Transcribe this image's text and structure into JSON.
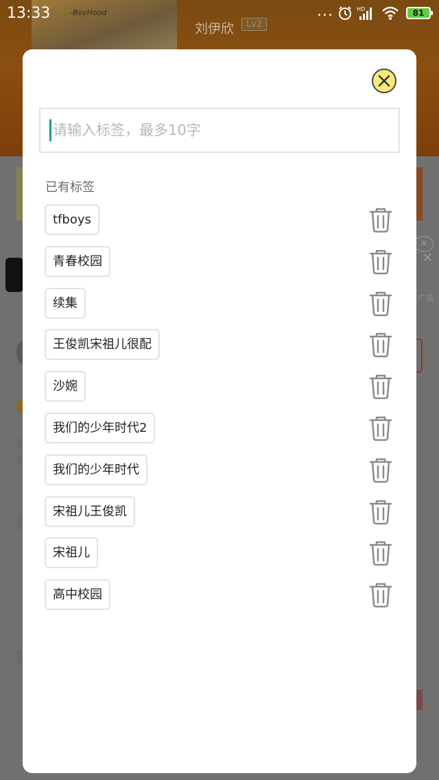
{
  "status_bar": {
    "time": "13:33",
    "dots": "...",
    "network_label": "HD",
    "battery": "81",
    "battery_color": "#5bcf3c"
  },
  "background": {
    "poster_text": "-BoyHood",
    "author": "刘伊欣",
    "author_level": "Lv2",
    "ad_label": "广告"
  },
  "modal": {
    "close_icon": "close-icon",
    "close_color": "#f8e97a",
    "input": {
      "value": "",
      "placeholder": "请输入标签，最多10字"
    },
    "section_title": "已有标签",
    "tags": [
      {
        "label": "tfboys"
      },
      {
        "label": "青春校园"
      },
      {
        "label": "续集"
      },
      {
        "label": "王俊凯宋祖儿很配"
      },
      {
        "label": "沙婉"
      },
      {
        "label": "我们的少年时代2"
      },
      {
        "label": "我们的少年时代"
      },
      {
        "label": "宋祖儿王俊凯"
      },
      {
        "label": "宋祖儿"
      },
      {
        "label": "高中校园"
      }
    ],
    "delete_icon": "trash-icon",
    "accent_color": "#1e9a8a"
  }
}
